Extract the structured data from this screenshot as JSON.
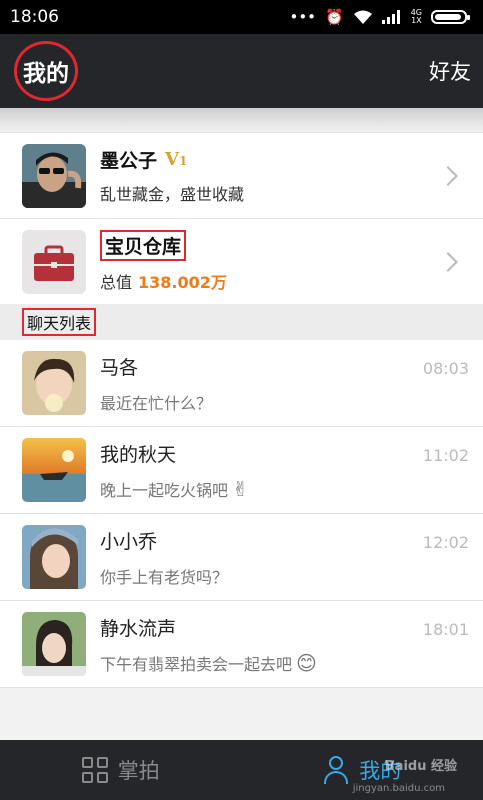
{
  "status_bar": {
    "time": "18:06",
    "dots": "•••",
    "network": "4G",
    "sim": "1X"
  },
  "header": {
    "title": "我的",
    "friends_label": "好友"
  },
  "profile": {
    "name": "墨公子",
    "vip": "V",
    "vip_level": "1",
    "motto": "乱世藏金，盛世收藏"
  },
  "warehouse": {
    "title": "宝贝仓库",
    "value_label": "总值",
    "value": "138.002万"
  },
  "chat_section_title": "聊天列表",
  "chats": [
    {
      "name": "马各",
      "time": "08:03",
      "message": "最近在忙什么？",
      "emoji": ""
    },
    {
      "name": "我的秋天",
      "time": "11:02",
      "message": "晚上一起吃火锅吧",
      "emoji": "✌"
    },
    {
      "name": "小小乔",
      "time": "12:02",
      "message": "你手上有老货吗？",
      "emoji": ""
    },
    {
      "name": "静水流声",
      "time": "18:01",
      "message": "下午有翡翠拍卖会一起去吧",
      "emoji": "😊"
    }
  ],
  "tabs": [
    {
      "label": "掌拍",
      "icon": "grid-icon",
      "active": false
    },
    {
      "label": "我的",
      "icon": "user-icon",
      "active": true
    }
  ],
  "watermark": {
    "text": "Baidu 经验",
    "url": "jingyan.baidu.com"
  },
  "colors": {
    "accent": "#3aa8e8",
    "highlight": "#e0282e",
    "value": "#f07a1a",
    "header_bg": "#24262a"
  }
}
